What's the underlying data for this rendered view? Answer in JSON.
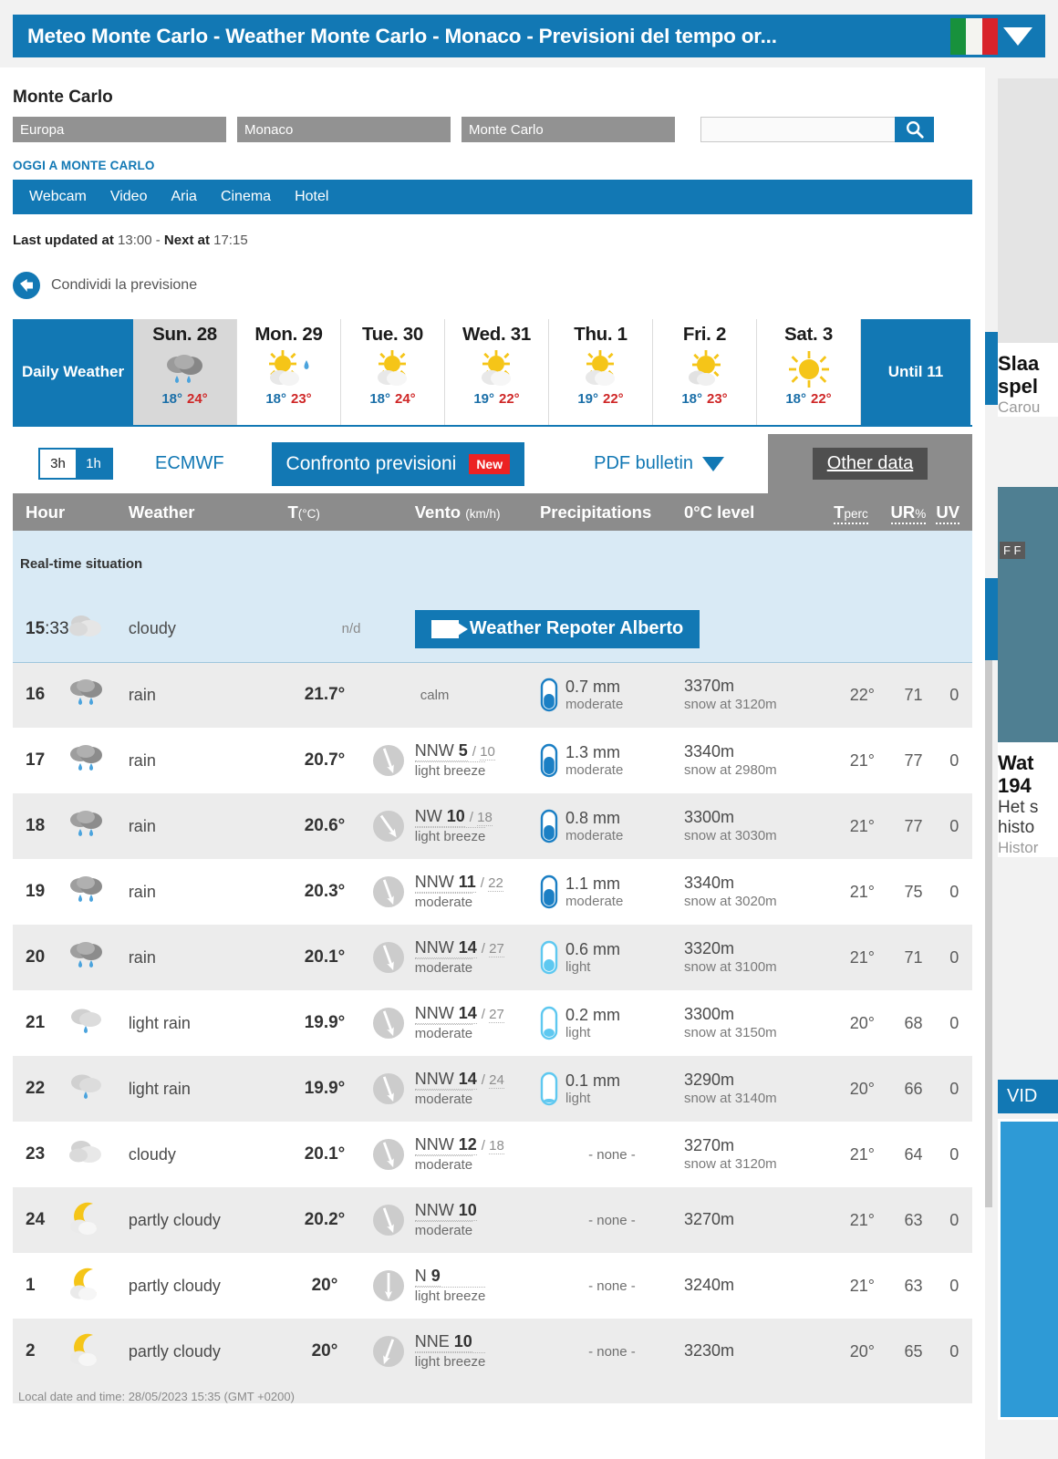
{
  "titlebar": {
    "title": "Meteo Monte Carlo - Weather Monte Carlo - Monaco - Previsioni del tempo or...",
    "flag": "italy-flag",
    "caret": "chevron-down-icon"
  },
  "header": {
    "city": "Monte Carlo",
    "breadcrumbs": [
      "Europa",
      "Monaco",
      "Monte Carlo"
    ],
    "search_value": "",
    "search_placeholder": "",
    "search_icon": "search-icon",
    "today_link": "OGGI A MONTE CARLO"
  },
  "nav": {
    "items": [
      "Webcam",
      "Video",
      "Aria",
      "Cinema",
      "Hotel"
    ]
  },
  "updated": {
    "label1": "Last updated at",
    "time1": "13:00",
    "sep": " - ",
    "label2": "Next at",
    "time2": "17:15"
  },
  "share": {
    "label": "Condividi la previsione",
    "icon": "share-icon"
  },
  "daily": {
    "header": "Daily Weather",
    "until": "Until 11",
    "days": [
      {
        "name": "Sun. 28",
        "icon": "rain",
        "min": "18°",
        "max": "24°",
        "selected": true
      },
      {
        "name": "Mon. 29",
        "icon": "partly-cloudy-drop",
        "min": "18°",
        "max": "23°",
        "selected": false
      },
      {
        "name": "Tue. 30",
        "icon": "partly-cloudy",
        "min": "18°",
        "max": "24°",
        "selected": false
      },
      {
        "name": "Wed. 31",
        "icon": "partly-cloudy",
        "min": "19°",
        "max": "22°",
        "selected": false
      },
      {
        "name": "Thu. 1",
        "icon": "partly-cloudy",
        "min": "19°",
        "max": "22°",
        "selected": false
      },
      {
        "name": "Fri. 2",
        "icon": "partly-cloudy",
        "min": "18°",
        "max": "23°",
        "selected": false
      },
      {
        "name": "Sat. 3",
        "icon": "sunny",
        "min": "18°",
        "max": "22°",
        "selected": false
      }
    ]
  },
  "toolbar": {
    "hr3": "3h",
    "hr1": "1h",
    "hr_selected": "1h",
    "model": "ECMWF",
    "compare": "Confronto previsioni",
    "compare_badge": "New",
    "pdf": "PDF bulletin",
    "pdf_caret": "chevron-down-icon",
    "other_data": "Other data"
  },
  "table": {
    "columns": {
      "hour": "Hour",
      "weather": "Weather",
      "t": "T",
      "t_unit": "(°C)",
      "wind": "Vento",
      "wind_unit": "(km/h)",
      "precip": "Precipitations",
      "zero": "0°C level",
      "tperc_a": "T",
      "tperc_b": "perc",
      "ur_a": "UR",
      "ur_b": "%",
      "uv": "UV"
    },
    "realtime_label": "Real-time situation",
    "realtime": {
      "hour": "15",
      "minute": ":33",
      "icon": "cloudy",
      "desc": "cloudy",
      "t": "n/d",
      "reporter": "Weather Repoter Alberto",
      "reporter_icon": "webcam-icon"
    },
    "rows": [
      {
        "hour": "16",
        "icon": "rain",
        "desc": "rain",
        "t": "21.7°",
        "wind_dir": "",
        "wind_speed": "",
        "wind_gust": "",
        "wind_desc": "",
        "wind_calm": "calm",
        "wind_angle": null,
        "precip_mm": "0.7 mm",
        "precip_class": "moderate",
        "precip_fill": 0.6,
        "zero": "3370m",
        "snow": "snow at 3120m",
        "tperc": "22°",
        "ur": "71",
        "uv": "0",
        "alt": true
      },
      {
        "hour": "17",
        "icon": "rain",
        "desc": "rain",
        "t": "20.7°",
        "wind_dir": "NNW",
        "wind_speed": "5",
        "wind_gust": "10",
        "wind_desc": "light breeze",
        "wind_calm": "",
        "wind_angle": 160,
        "precip_mm": "1.3 mm",
        "precip_class": "moderate",
        "precip_fill": 0.72,
        "zero": "3340m",
        "snow": "snow at 2980m",
        "tperc": "21°",
        "ur": "77",
        "uv": "0",
        "alt": false
      },
      {
        "hour": "18",
        "icon": "rain",
        "desc": "rain",
        "t": "20.6°",
        "wind_dir": "NW",
        "wind_speed": "10",
        "wind_gust": "18",
        "wind_desc": "light breeze",
        "wind_calm": "",
        "wind_angle": 145,
        "precip_mm": "0.8 mm",
        "precip_class": "moderate",
        "precip_fill": 0.62,
        "zero": "3300m",
        "snow": "snow at 3030m",
        "tperc": "21°",
        "ur": "77",
        "uv": "0",
        "alt": true
      },
      {
        "hour": "19",
        "icon": "rain",
        "desc": "rain",
        "t": "20.3°",
        "wind_dir": "NNW",
        "wind_speed": "11",
        "wind_gust": "22",
        "wind_desc": "moderate",
        "wind_calm": "",
        "wind_angle": 160,
        "precip_mm": "1.1 mm",
        "precip_class": "moderate",
        "precip_fill": 0.68,
        "zero": "3340m",
        "snow": "snow at 3020m",
        "tperc": "21°",
        "ur": "75",
        "uv": "0",
        "alt": false
      },
      {
        "hour": "20",
        "icon": "rain",
        "desc": "rain",
        "t": "20.1°",
        "wind_dir": "NNW",
        "wind_speed": "14",
        "wind_gust": "27",
        "wind_desc": "moderate",
        "wind_calm": "",
        "wind_angle": 160,
        "precip_mm": "0.6 mm",
        "precip_class": "light",
        "precip_fill": 0.5,
        "zero": "3320m",
        "snow": "snow at 3100m",
        "tperc": "21°",
        "ur": "71",
        "uv": "0",
        "alt": true
      },
      {
        "hour": "21",
        "icon": "light-rain",
        "desc": "light rain",
        "t": "19.9°",
        "wind_dir": "NNW",
        "wind_speed": "14",
        "wind_gust": "27",
        "wind_desc": "moderate",
        "wind_calm": "",
        "wind_angle": 160,
        "precip_mm": "0.2 mm",
        "precip_class": "light",
        "precip_fill": 0.36,
        "zero": "3300m",
        "snow": "snow at 3150m",
        "tperc": "20°",
        "ur": "68",
        "uv": "0",
        "alt": false
      },
      {
        "hour": "22",
        "icon": "light-rain",
        "desc": "light rain",
        "t": "19.9°",
        "wind_dir": "NNW",
        "wind_speed": "14",
        "wind_gust": "24",
        "wind_desc": "moderate",
        "wind_calm": "",
        "wind_angle": 160,
        "precip_mm": "0.1 mm",
        "precip_class": "light",
        "precip_fill": 0.1,
        "zero": "3290m",
        "snow": "snow at 3140m",
        "tperc": "20°",
        "ur": "66",
        "uv": "0",
        "alt": true
      },
      {
        "hour": "23",
        "icon": "cloudy",
        "desc": "cloudy",
        "t": "20.1°",
        "wind_dir": "NNW",
        "wind_speed": "12",
        "wind_gust": "18",
        "wind_desc": "moderate",
        "wind_calm": "",
        "wind_angle": 160,
        "precip_mm": "",
        "precip_class": "",
        "precip_fill": 0,
        "precip_none": "- none -",
        "zero": "3270m",
        "snow": "snow at 3120m",
        "tperc": "21°",
        "ur": "64",
        "uv": "0",
        "alt": false
      },
      {
        "hour": "24",
        "icon": "partly-cloudy-night",
        "desc": "partly cloudy",
        "t": "20.2°",
        "wind_dir": "NNW",
        "wind_speed": "10",
        "wind_gust": "",
        "wind_desc": "moderate",
        "wind_calm": "",
        "wind_angle": 160,
        "precip_mm": "",
        "precip_class": "",
        "precip_fill": 0,
        "precip_none": "- none -",
        "zero": "3270m",
        "snow": "",
        "tperc": "21°",
        "ur": "63",
        "uv": "0",
        "alt": true
      },
      {
        "hour": "1",
        "icon": "partly-cloudy-night",
        "desc": "partly cloudy",
        "t": "20°",
        "wind_dir": "N",
        "wind_speed": "9",
        "wind_gust": "",
        "wind_desc": "light breeze",
        "wind_calm": "",
        "wind_angle": 180,
        "precip_mm": "",
        "precip_class": "",
        "precip_fill": 0,
        "precip_none": "- none -",
        "zero": "3240m",
        "snow": "",
        "tperc": "21°",
        "ur": "63",
        "uv": "0",
        "alt": false
      },
      {
        "hour": "2",
        "icon": "partly-cloudy-night",
        "desc": "partly cloudy",
        "t": "20°",
        "wind_dir": "NNE",
        "wind_speed": "10",
        "wind_gust": "",
        "wind_desc": "light breeze",
        "wind_calm": "",
        "wind_angle": 200,
        "precip_mm": "",
        "precip_class": "",
        "precip_fill": 0,
        "precip_none": "- none -",
        "zero": "3230m",
        "snow": "",
        "tperc": "20°",
        "ur": "65",
        "uv": "0",
        "alt": true
      }
    ],
    "footer": "Local date and time: 28/05/2023 15:35 (GMT +0200)"
  },
  "rail": {
    "article1_title": "Slaa\nspel",
    "article1_source": "Carou",
    "article2_title": "Wat\n194",
    "article2_sub": "Het s\nhisto",
    "article2_source": "Histor",
    "video_label": "VID",
    "map_label": "F F"
  },
  "colors": {
    "brand": "#1278b4",
    "badge_red": "#ec2222",
    "grey_header": "#8c8c8c"
  }
}
